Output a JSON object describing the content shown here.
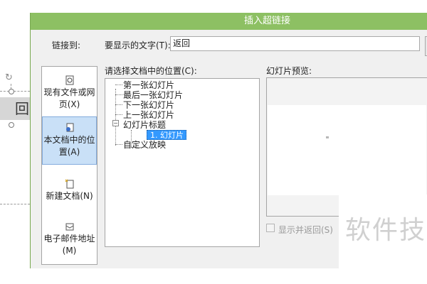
{
  "dialog": {
    "title": "插入超链接",
    "link_to_label": "链接到:",
    "text_to_display_label": "要显示的文字(T):",
    "text_to_display_value": "返回",
    "select_place_label": "请选择文档中的位置(C):",
    "preview_label": "幻灯片预览:",
    "show_and_return_label": "显示并返回(S)"
  },
  "link_to": [
    {
      "label": "现有文件或网页(X)",
      "icon": "web-page-icon",
      "active": false
    },
    {
      "label": "本文档中的位置(A)",
      "icon": "document-place-icon",
      "active": true
    },
    {
      "label": "新建文档(N)",
      "icon": "new-document-icon",
      "active": false
    },
    {
      "label": "电子邮件地址(M)",
      "icon": "email-icon",
      "active": false
    }
  ],
  "tree": [
    {
      "label": "第一张幻灯片"
    },
    {
      "label": "最后一张幻灯片"
    },
    {
      "label": "下一张幻灯片"
    },
    {
      "label": "上一张幻灯片"
    },
    {
      "label": "幻灯片标题",
      "expanded": true
    },
    {
      "label": "1. 幻灯片 1",
      "selected": true
    },
    {
      "label": "自定义放映"
    }
  ],
  "background_slide": {
    "text": "回"
  },
  "watermark": {
    "text": "软件技"
  },
  "colors": {
    "titlebar": "#8dc063",
    "selected": "#3399ff",
    "active_link": "#c9e0f7"
  }
}
